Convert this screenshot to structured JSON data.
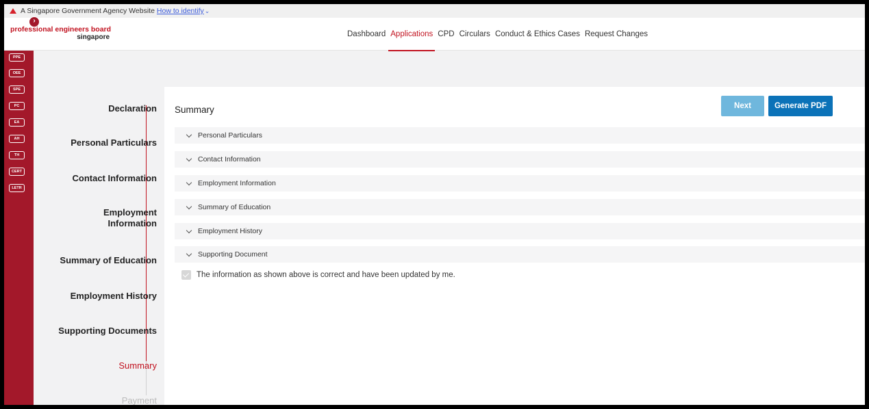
{
  "gov_banner": {
    "text": "A Singapore Government Agency Website",
    "link": "How to identify"
  },
  "logo": {
    "line1": "professional engineers board",
    "line2": "singapore"
  },
  "nav": {
    "items": [
      "Dashboard",
      "Applications",
      "CPD",
      "Circulars",
      "Conduct & Ethics Cases",
      "Request Changes"
    ],
    "active": "Applications"
  },
  "rail": {
    "items": [
      "PPE",
      "OEE",
      "SPE",
      "PC",
      "EA",
      "AH",
      "TH",
      "CERT",
      "LETR"
    ]
  },
  "stepper": {
    "steps": [
      {
        "label": "Declaration",
        "state": "done"
      },
      {
        "label": "Personal Particulars",
        "state": "done"
      },
      {
        "label": "Contact Information",
        "state": "done"
      },
      {
        "label": "Employment Information",
        "state": "done"
      },
      {
        "label": "Summary of Education",
        "state": "done"
      },
      {
        "label": "Employment History",
        "state": "done"
      },
      {
        "label": "Supporting Documents",
        "state": "done"
      },
      {
        "label": "Summary",
        "state": "current"
      },
      {
        "label": "Payment",
        "state": "future"
      }
    ]
  },
  "main": {
    "title": "Summary",
    "next_label": "Next",
    "pdf_label": "Generate PDF",
    "sections": [
      "Personal Particulars",
      "Contact Information",
      "Employment Information",
      "Summary of Education",
      "Employment History",
      "Supporting Document"
    ],
    "declaration": "The information as shown above is correct and have been updated by me."
  },
  "colors": {
    "brand_red": "#c1121f",
    "rail_red": "#a3182a",
    "next_blue": "#6fb7dd",
    "pdf_blue": "#0b72b8"
  }
}
